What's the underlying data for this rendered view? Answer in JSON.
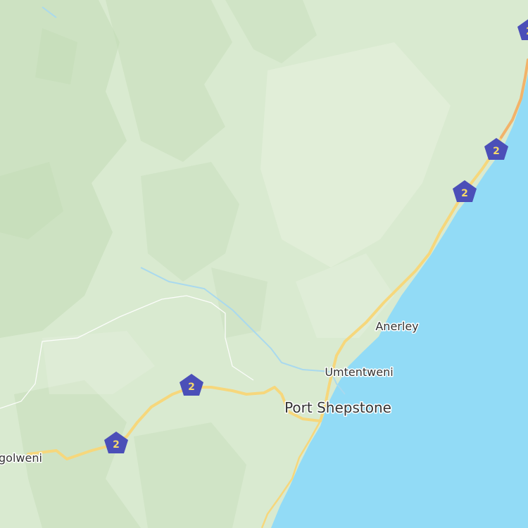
{
  "map": {
    "colors": {
      "land": "#d9ead0",
      "terrain_dark": "#c3dbb6",
      "terrain_light": "#e7f1df",
      "ocean": "#92dbf6",
      "river": "#a9d9ee",
      "highway": "#f6d77c",
      "highway_major": "#f2b36a",
      "shield": "#4b4fb8",
      "shield_text": "#f5d96b",
      "boundary": "#ffffff",
      "label": "#333333"
    },
    "places": {
      "port_shepstone": "Port Shepstone",
      "umtentweni": "Umtentweni",
      "anerley": "Anerley",
      "izingolweni": "golweni"
    },
    "route_shields": [
      {
        "id": "shield-1",
        "label": "2"
      },
      {
        "id": "shield-2",
        "label": "2"
      },
      {
        "id": "shield-3",
        "label": "2"
      },
      {
        "id": "shield-4",
        "label": "2"
      },
      {
        "id": "shield-5",
        "label": "2"
      }
    ]
  }
}
